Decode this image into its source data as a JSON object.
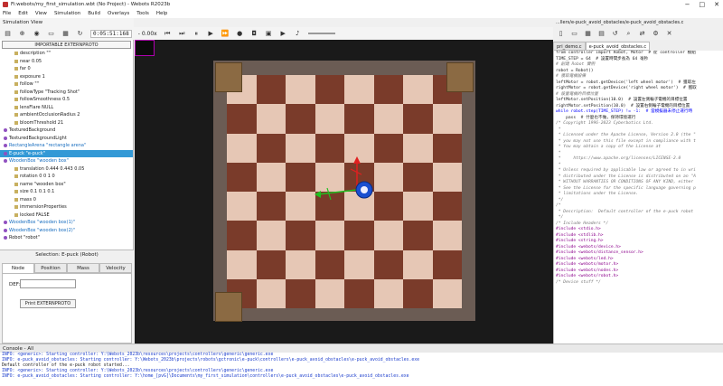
{
  "window": {
    "title": "Fi:webots/my_first_simulation.wbt (No Project) - Webots R2023b",
    "controls": [
      "−",
      "□",
      "✕"
    ]
  },
  "menu": [
    "File",
    "Edit",
    "View",
    "Simulation",
    "Build",
    "Overlays",
    "Tools",
    "Help"
  ],
  "scene_view_label": "Simulation View",
  "toolbar": {
    "time": "0:05:51:168",
    "speed": "- 0.00x"
  },
  "scene_tree": {
    "button": "IMPORTABLE EXTERNPROTO",
    "rows": [
      {
        "label": "description \"\"",
        "indent": 2,
        "marker": "sq"
      },
      {
        "label": "near 0.05",
        "indent": 2,
        "marker": "sq"
      },
      {
        "label": "far 0",
        "indent": 2,
        "marker": "sq"
      },
      {
        "label": "exposure 1",
        "indent": 2,
        "marker": "sq"
      },
      {
        "label": "follow \"\"",
        "indent": 2,
        "marker": "sq"
      },
      {
        "label": "followType \"Tracking Shot\"",
        "indent": 2,
        "marker": "sq"
      },
      {
        "label": "followSmoothness 0.5",
        "indent": 2,
        "marker": "sq"
      },
      {
        "label": "lensFlare NULL",
        "indent": 2,
        "marker": "sq"
      },
      {
        "label": "ambientOcclusionRadius 2",
        "indent": 2,
        "marker": "sq"
      },
      {
        "label": "bloomThreshold 21",
        "indent": 2,
        "marker": "sq"
      },
      {
        "label": "TexturedBackground",
        "indent": 0,
        "marker": "dot"
      },
      {
        "label": "TexturedBackgroundLight",
        "indent": 0,
        "marker": "dot"
      },
      {
        "label": "RectangleArena \"rectangle arena\"",
        "indent": 0,
        "marker": "dot"
      },
      {
        "label": "E-puck \"e-puck\"",
        "indent": 0,
        "marker": "dot",
        "selected": true
      },
      {
        "label": "WoodenBox \"wooden box\"",
        "indent": 0,
        "marker": "dot"
      },
      {
        "label": "translation 0.444 0.443 0.05",
        "indent": 2,
        "marker": "sq"
      },
      {
        "label": "rotation 0 0 1 0",
        "indent": 2,
        "marker": "sq"
      },
      {
        "label": "name \"wooden box\"",
        "indent": 2,
        "marker": "sq"
      },
      {
        "label": "size 0.1 0.1 0.1",
        "indent": 2,
        "marker": "sq"
      },
      {
        "label": "mass 0",
        "indent": 2,
        "marker": "sq"
      },
      {
        "label": "immersionProperties",
        "indent": 2,
        "marker": "sq"
      },
      {
        "label": "locked FALSE",
        "indent": 2,
        "marker": "sq"
      },
      {
        "label": "WoodenBox \"wooden box(1)\"",
        "indent": 0,
        "marker": "dot"
      },
      {
        "label": "WoodenBox \"wooden box(2)\"",
        "indent": 0,
        "marker": "dot"
      },
      {
        "label": "Robot \"robot\"",
        "indent": 0,
        "marker": "dot"
      }
    ]
  },
  "selection_label": "Selection: E-puck (Robot)",
  "field_tabs": [
    "Node",
    "Position",
    "Mass",
    "Velocity"
  ],
  "node_panel": {
    "def_label": "DEF:",
    "def_value": "",
    "print_button": "Print EXTERNPROTO"
  },
  "editor": {
    "path": "...llers/e-puck_avoid_obstacles/e-puck_avoid_obstacles.c",
    "tabs": [
      "pri_demo.c",
      "e-puck_avoid_obstacles.c"
    ],
    "lines": [
      {
        "t": "from controller import Robot, Motor  # 從 controller 模組",
        "c": ""
      },
      {
        "t": "",
        "c": ""
      },
      {
        "t": "TIME_STEP = 64  # 設置時間步長為 64 毫秒",
        "c": ""
      },
      {
        "t": "",
        "c": ""
      },
      {
        "t": "# 創建 Robot 實例",
        "c": "cm"
      },
      {
        "t": "robot = Robot()",
        "c": ""
      },
      {
        "t": "",
        "c": ""
      },
      {
        "t": "# 獲取電機設備",
        "c": "cm"
      },
      {
        "t": "leftMotor = robot.getDevice('left wheel motor')  # 獲取左",
        "c": ""
      },
      {
        "t": "rightMotor = robot.getDevice('right wheel motor')  # 獲取",
        "c": ""
      },
      {
        "t": "",
        "c": ""
      },
      {
        "t": "# 設置電機的目標位置",
        "c": "cm"
      },
      {
        "t": "leftMotor.setPosition(10.0)  # 設置左側輪子電機的目標位置",
        "c": ""
      },
      {
        "t": "rightMotor.setPosition(10.0)  # 設置右側輪子電機的目標位置",
        "c": ""
      },
      {
        "t": "",
        "c": ""
      },
      {
        "t": "while robot.step(TIME_STEP) != -1:  # 當模擬器未停止運行時",
        "c": "kw"
      },
      {
        "t": "    pass  # 什麼也不做，保持環境運行",
        "c": ""
      },
      {
        "t": "/* Copyright 1996-2023 Cyberbotics Ltd.",
        "c": "cm"
      },
      {
        "t": " *",
        "c": "cm"
      },
      {
        "t": " * Licensed under the Apache License, Version 2.0 (the \"",
        "c": "cm"
      },
      {
        "t": " * you may not use this file except in compliance with t",
        "c": "cm"
      },
      {
        "t": " * You may obtain a copy of the License at",
        "c": "cm"
      },
      {
        "t": " *",
        "c": "cm"
      },
      {
        "t": " *     https://www.apache.org/licenses/LICENSE-2.0",
        "c": "cm"
      },
      {
        "t": " *",
        "c": "cm"
      },
      {
        "t": " * Unless required by applicable law or agreed to in wri",
        "c": "cm"
      },
      {
        "t": " * distributed under the License is distributed on an \"A",
        "c": "cm"
      },
      {
        "t": " * WITHOUT WARRANTIES OR CONDITIONS OF ANY KIND, either",
        "c": "cm"
      },
      {
        "t": " * See the License for the specific language governing p",
        "c": "cm"
      },
      {
        "t": " * limitations under the License.",
        "c": "cm"
      },
      {
        "t": " */",
        "c": "cm"
      },
      {
        "t": "",
        "c": ""
      },
      {
        "t": "/*",
        "c": "cm"
      },
      {
        "t": " * Description:  Default controller of the e-puck robot",
        "c": "cm"
      },
      {
        "t": " */",
        "c": "cm"
      },
      {
        "t": "",
        "c": ""
      },
      {
        "t": "/* Include Headers */",
        "c": "cm"
      },
      {
        "t": "#include <stdio.h>",
        "c": "pp"
      },
      {
        "t": "#include <stdlib.h>",
        "c": "pp"
      },
      {
        "t": "#include <string.h>",
        "c": "pp"
      },
      {
        "t": "",
        "c": ""
      },
      {
        "t": "#include <webots/device.h>",
        "c": "pp"
      },
      {
        "t": "#include <webots/distance_sensor.h>",
        "c": "pp"
      },
      {
        "t": "#include <webots/led.h>",
        "c": "pp"
      },
      {
        "t": "#include <webots/motor.h>",
        "c": "pp"
      },
      {
        "t": "#include <webots/nodes.h>",
        "c": "pp"
      },
      {
        "t": "#include <webots/robot.h>",
        "c": "pp"
      },
      {
        "t": "",
        "c": ""
      },
      {
        "t": "/* Device stuff */",
        "c": "cm"
      }
    ]
  },
  "console": {
    "header": "Console - All",
    "lines": [
      {
        "t": "INFO: <generic>: Starting controller: Y:\\Webots_2023b\\resources\\projects\\controllers\\generic\\generic.exe",
        "c": "info"
      },
      {
        "t": "INFO: e-puck_avoid_obstacles: Starting controller: Y:\\Webots_2023b\\projects\\robots\\gctronic\\e-puck\\controllers\\e-puck_avoid_obstacles\\e-puck_avoid_obstacles.exe",
        "c": "info"
      },
      {
        "t": "Default controller of the e-puck robot started...",
        "c": ""
      },
      {
        "t": "INFO: <generic>: Starting controller: Y:\\Webots_2023b\\resources\\projects\\controllers\\generic\\generic.exe",
        "c": "info"
      },
      {
        "t": "INFO: e-puck_avoid_obstacles: Starting controller: Y:\\home_[pvG]\\Documents\\my_first_simulation\\controllers\\e-puck_avoid_obstacles\\e-puck_avoid_obstacles.exe",
        "c": "info"
      }
    ]
  }
}
